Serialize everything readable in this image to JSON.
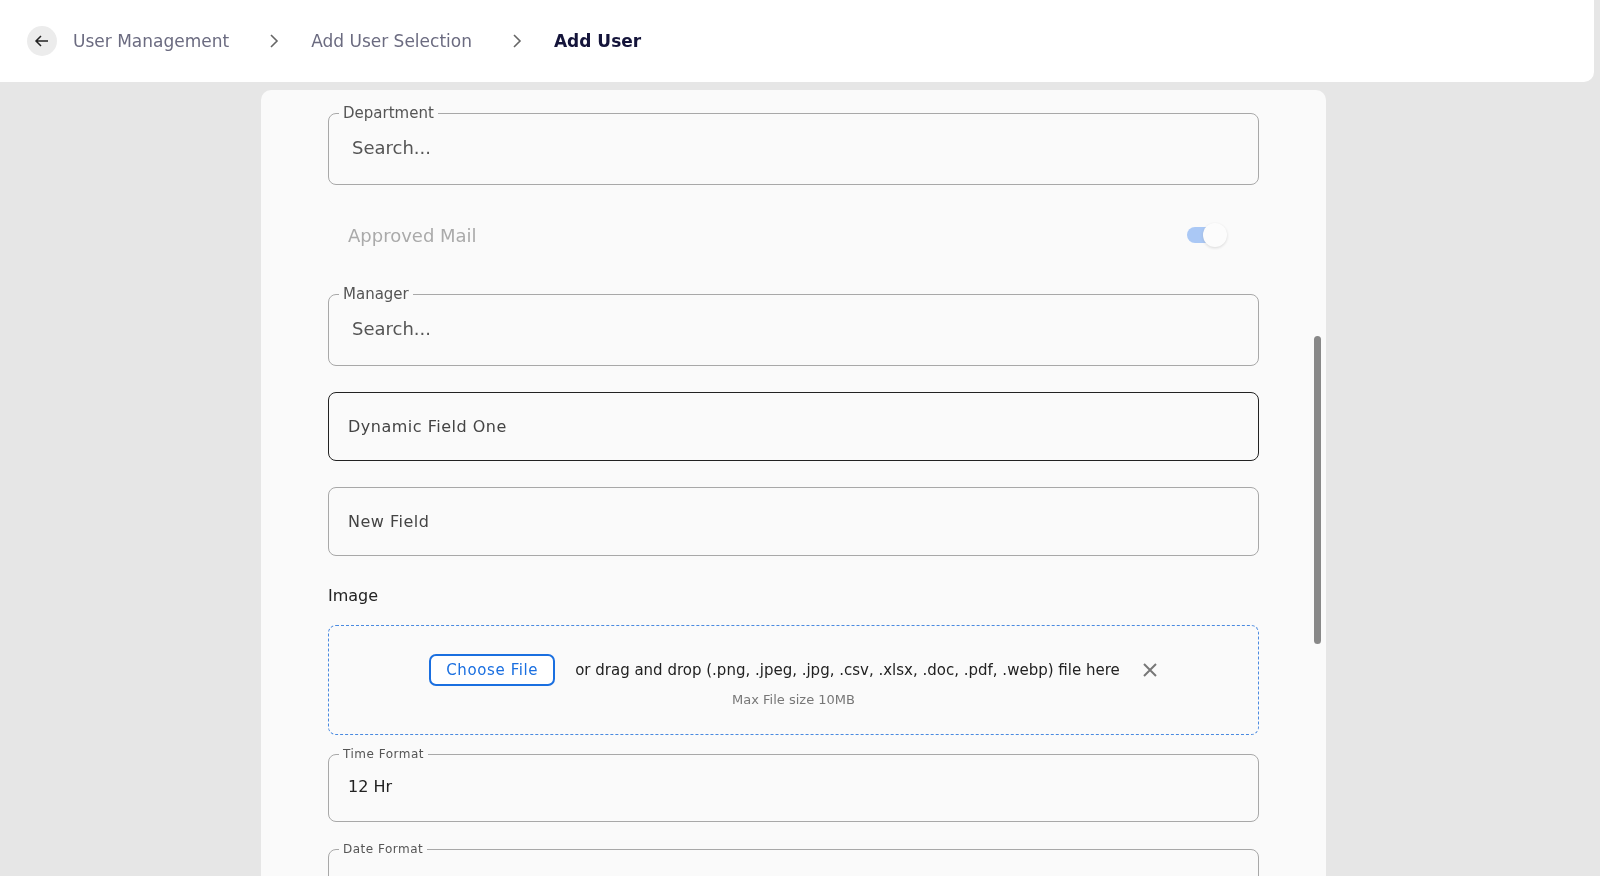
{
  "breadcrumb": [
    {
      "label": "User Management",
      "current": false
    },
    {
      "label": "Add User Selection",
      "current": false
    },
    {
      "label": "Add User",
      "current": true
    }
  ],
  "form": [
    {
      "kind": "search",
      "label": "Department",
      "placeholder": "Search..."
    },
    {
      "kind": "toggle",
      "label": "Approved Mail",
      "on": true,
      "disabled": true
    },
    {
      "kind": "search",
      "label": "Manager",
      "placeholder": "Search..."
    },
    {
      "kind": "text",
      "placeholder": "Dynamic Field One",
      "focused": true
    },
    {
      "kind": "text",
      "placeholder": "New Field",
      "focused": false
    },
    {
      "kind": "upload",
      "label": "Image",
      "button": "Choose File",
      "hint": "or drag and drop (.png, .jpeg, .jpg, .csv, .xlsx, .doc, .pdf, .webp) file here",
      "note": "Max File size 10MB"
    },
    {
      "kind": "select",
      "label": "Time Format",
      "value": "12 Hr"
    },
    {
      "kind": "select",
      "label": "Date Format"
    }
  ]
}
